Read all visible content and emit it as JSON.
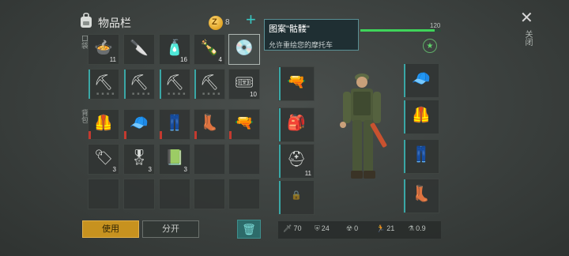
{
  "header": {
    "title": "物品栏",
    "coin_symbol": "Z",
    "coin_count": "8",
    "add_symbol": "+"
  },
  "sections": {
    "backpack": "背包",
    "pocket": "口袋"
  },
  "inventory": {
    "row1": [
      {
        "icon": "food-bowl-icon",
        "glyph": "🍲",
        "qty": "11"
      },
      {
        "icon": "machete-icon",
        "glyph": "🔪",
        "qty": ""
      },
      {
        "icon": "water-bottle-icon",
        "glyph": "🧴",
        "qty": "16"
      },
      {
        "icon": "empty-bottle-icon",
        "glyph": "🍾",
        "qty": "4"
      },
      {
        "icon": "skeleton-pattern-icon",
        "glyph": "💿",
        "qty": ""
      }
    ],
    "row2": [
      {
        "icon": "pickaxe-icon",
        "glyph": "⛏",
        "qty": ""
      },
      {
        "icon": "pickaxe-icon",
        "glyph": "⛏",
        "qty": ""
      },
      {
        "icon": "pickaxe-icon",
        "glyph": "⛏",
        "qty": ""
      },
      {
        "icon": "pickaxe-icon",
        "glyph": "⛏",
        "qty": ""
      },
      {
        "icon": "ticket-icon",
        "glyph": "🎟",
        "qty": "10"
      }
    ],
    "row3": [
      {
        "icon": "armor-vest-icon",
        "glyph": "🦺",
        "qty": ""
      },
      {
        "icon": "military-cap-icon",
        "glyph": "🧢",
        "qty": ""
      },
      {
        "icon": "camo-pants-icon",
        "glyph": "👖",
        "qty": ""
      },
      {
        "icon": "boots-icon",
        "glyph": "👢",
        "qty": ""
      },
      {
        "icon": "pistol-icon",
        "glyph": "🔫",
        "qty": ""
      }
    ],
    "row4": [
      {
        "icon": "dog-tag-icon",
        "glyph": "🏷",
        "qty": "3"
      },
      {
        "icon": "rank-badge-icon",
        "glyph": "🎖",
        "qty": "3"
      },
      {
        "icon": "notebook-icon",
        "glyph": "📗",
        "qty": "3"
      }
    ]
  },
  "tooltip": {
    "title": "图案\"骷髅\"",
    "desc": "允许重绘您的摩托车"
  },
  "health": {
    "value": "120",
    "fraction": 0.92
  },
  "gear": {
    "weapon": {
      "icon": "shotgun-icon",
      "glyph": "🔫"
    },
    "backpack": {
      "icon": "backpack-icon",
      "glyph": "🎒"
    },
    "medkit": {
      "icon": "medkit-icon",
      "glyph": "⛑",
      "qty": "11"
    },
    "locked": {
      "icon": "lock-icon",
      "glyph": "🔒"
    },
    "head": {
      "icon": "military-cap-icon",
      "glyph": "🧢"
    },
    "body": {
      "icon": "armor-vest-icon",
      "glyph": "🦺"
    },
    "legs": {
      "icon": "camo-pants-icon",
      "glyph": "👖"
    },
    "feet": {
      "icon": "boots-icon",
      "glyph": "👢"
    }
  },
  "buttons": {
    "use": "使用",
    "split": "分开",
    "trash_glyph": "🗑"
  },
  "close": {
    "glyph": "✕",
    "label": "关闭"
  },
  "stats": [
    {
      "icon": "attack-icon",
      "glyph": "🗡",
      "value": "70"
    },
    {
      "icon": "defense-icon",
      "glyph": "⛨",
      "value": "24"
    },
    {
      "icon": "radiation-icon",
      "glyph": "☢",
      "value": "0"
    },
    {
      "icon": "speed-icon",
      "glyph": "🏃",
      "value": "21"
    },
    {
      "icon": "stealth-icon",
      "glyph": "⚗",
      "value": "0.9"
    }
  ],
  "colors": {
    "accent": "#38c6c2",
    "use_button": "#c7921f",
    "health": "#3fd45a"
  }
}
